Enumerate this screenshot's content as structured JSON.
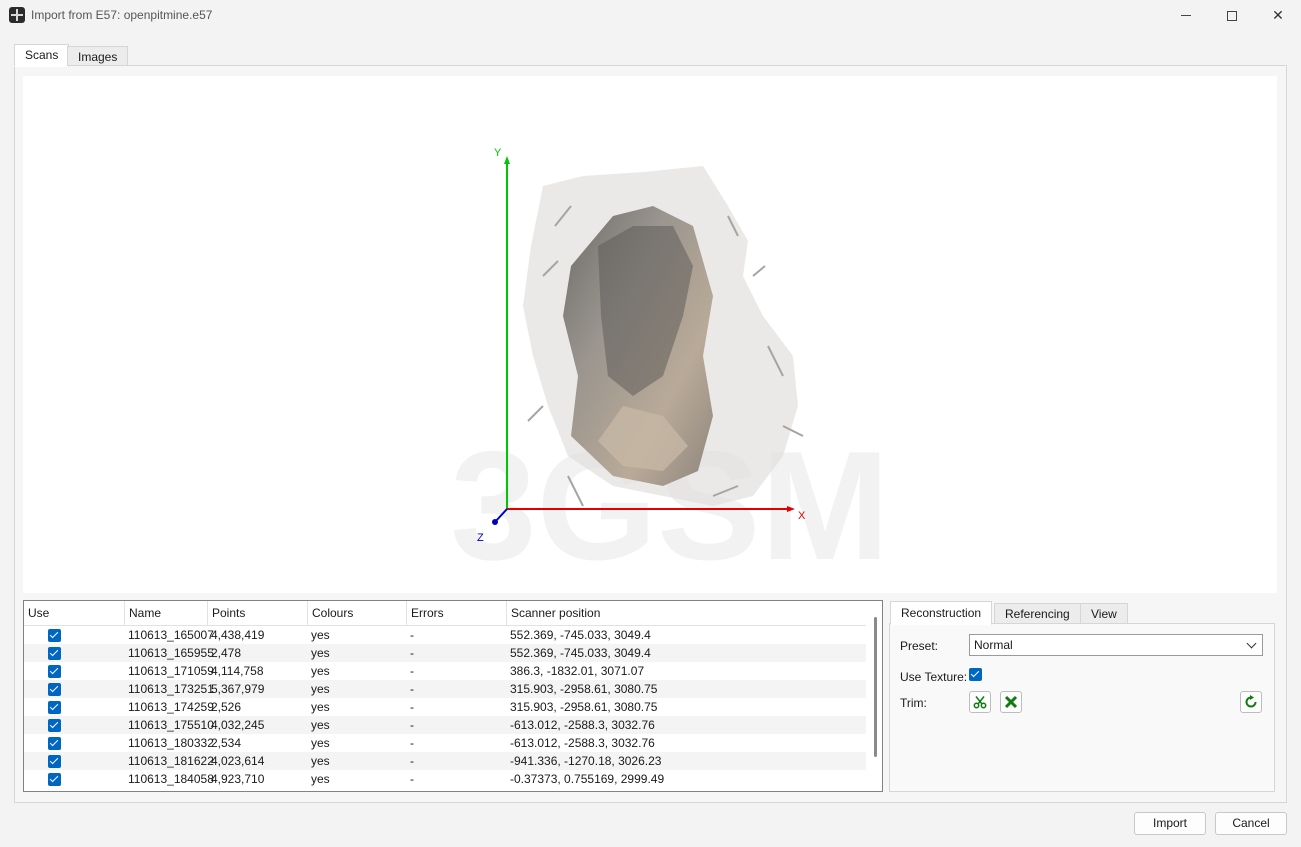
{
  "window": {
    "title": "Import from E57: openpitmine.e57",
    "minimize_icon": "minimize-icon",
    "maximize_icon": "maximize-icon",
    "close_glyph": "✕"
  },
  "tabs": {
    "scans": "Scans",
    "images": "Images"
  },
  "viewport": {
    "watermark": "3GSM",
    "axes": {
      "x": "X",
      "y": "Y",
      "z": "Z"
    },
    "axis_colors": {
      "x": "#e00000",
      "y": "#00c800",
      "z": "#0000c0"
    }
  },
  "table": {
    "columns": [
      "Use",
      "Name",
      "Points",
      "Colours",
      "Errors",
      "Scanner position"
    ],
    "rows": [
      {
        "use": true,
        "name": "110613_165007",
        "points": "4,438,419",
        "colours": "yes",
        "errors": "-",
        "position": "552.369, -745.033, 3049.4"
      },
      {
        "use": true,
        "name": "110613_165955",
        "points": "2,478",
        "colours": "yes",
        "errors": "-",
        "position": "552.369, -745.033, 3049.4"
      },
      {
        "use": true,
        "name": "110613_171059",
        "points": "4,114,758",
        "colours": "yes",
        "errors": "-",
        "position": "386.3, -1832.01, 3071.07"
      },
      {
        "use": true,
        "name": "110613_173251",
        "points": "5,367,979",
        "colours": "yes",
        "errors": "-",
        "position": "315.903, -2958.61, 3080.75"
      },
      {
        "use": true,
        "name": "110613_174259",
        "points": "2,526",
        "colours": "yes",
        "errors": "-",
        "position": "315.903, -2958.61, 3080.75"
      },
      {
        "use": true,
        "name": "110613_175510",
        "points": "4,032,245",
        "colours": "yes",
        "errors": "-",
        "position": "-613.012, -2588.3, 3032.76"
      },
      {
        "use": true,
        "name": "110613_180332",
        "points": "2,534",
        "colours": "yes",
        "errors": "-",
        "position": "-613.012, -2588.3, 3032.76"
      },
      {
        "use": true,
        "name": "110613_181622",
        "points": "4,023,614",
        "colours": "yes",
        "errors": "-",
        "position": "-941.336, -1270.18, 3026.23"
      },
      {
        "use": true,
        "name": "110613_184058",
        "points": "4,923,710",
        "colours": "yes",
        "errors": "-",
        "position": "-0.37373, 0.755169, 2999.49"
      }
    ]
  },
  "side_panel": {
    "tabs": [
      "Reconstruction",
      "Referencing",
      "View"
    ],
    "preset_label": "Preset:",
    "preset_value": "Normal",
    "use_texture_label": "Use Texture:",
    "use_texture_checked": true,
    "trim_label": "Trim:",
    "trim_icons": [
      "scissors-icon",
      "clear-icon",
      "reset-icon"
    ]
  },
  "buttons": {
    "import": "Import",
    "cancel": "Cancel"
  }
}
